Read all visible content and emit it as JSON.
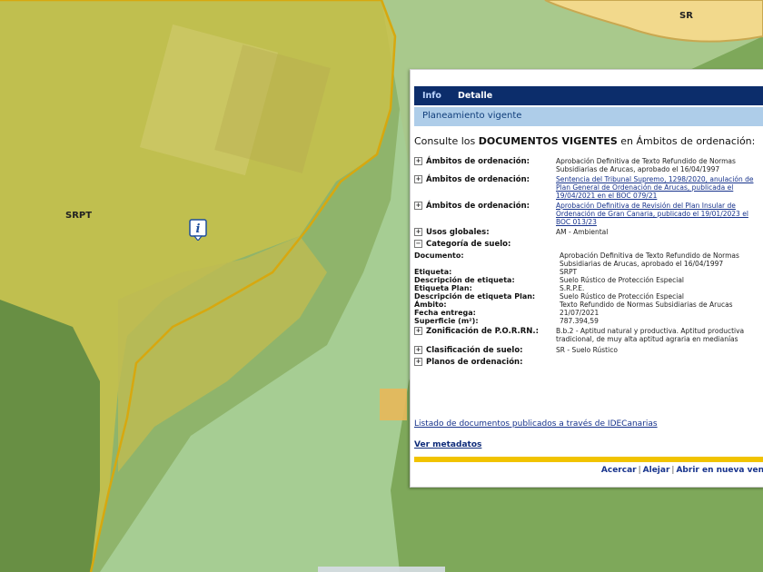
{
  "map": {
    "labels": {
      "top_right": "SR",
      "left": "SRPT"
    },
    "info_marker_letter": "i"
  },
  "panel": {
    "tabs": [
      "Info",
      "Detalle"
    ],
    "section_title": "Planeamiento vigente",
    "intro_prefix": "Consulte los ",
    "intro_bold": "DOCUMENTOS VIGENTES",
    "intro_suffix": " en Ámbitos de ordenación:",
    "rows": [
      {
        "label": "Ámbitos de ordenación:",
        "value": "Aprobación Definitiva de Texto Refundido de Normas Subsidiarias de Arucas, aprobado el 16/04/1997",
        "link": false
      },
      {
        "label": "Ámbitos de ordenación:",
        "value": "Sentencia del Tribunal Supremo, 1298/2020, anulación de Plan General de Ordenación de Arucas, publicada el 19/04/2021 en el BOC 079/21",
        "link": true
      },
      {
        "label": "Ámbitos de ordenación:",
        "value": "Aprobación Definitiva de Revisión del Plan Insular de Ordenación de Gran Canaria, publicado el 19/01/2023 el BOC 013/23",
        "link": true
      },
      {
        "label": "Usos globales:",
        "value": "AM - Ambiental",
        "link": false
      },
      {
        "label": "Categoría de suelo:",
        "value": "",
        "link": false
      }
    ],
    "detail": [
      {
        "label": "Documento:",
        "value": "Aprobación Definitiva de Texto Refundido de Normas Subsidiarias de Arucas, aprobado el 16/04/1997"
      },
      {
        "label": "Etiqueta:",
        "value": "SRPT"
      },
      {
        "label": "Descripción de etiqueta:",
        "value": "Suelo Rústico de Protección Especial"
      },
      {
        "label": "Etiqueta Plan:",
        "value": "S.R.P.E."
      },
      {
        "label": "Descripción de etiqueta Plan:",
        "value": "Suelo Rústico de Protección Especial"
      },
      {
        "label": "Ámbito:",
        "value": "Texto Refundido de Normas Subsidiarias de Arucas"
      },
      {
        "label": "Fecha entrega:",
        "value": "21/07/2021"
      },
      {
        "label": "Superficie (m²):",
        "value": "787.394,59"
      }
    ],
    "rows2": [
      {
        "label": "Zonificación de P.O.R.RN.:",
        "value": "B.b.2 - Aptitud natural y productiva. Aptitud productiva tradicional, de muy alta aptitud agraria en medianías"
      },
      {
        "label": "Clasificación de suelo:",
        "value": "SR - Suelo Rústico"
      },
      {
        "label": "Planos de ordenación:",
        "value": ""
      }
    ],
    "docs_link": "Listado de documentos publicados a través de IDECanarias",
    "metadata_link": "Ver metadatos",
    "bottom_links": [
      "Acercar",
      "Alejar",
      "Abrir en nueva ven"
    ]
  }
}
